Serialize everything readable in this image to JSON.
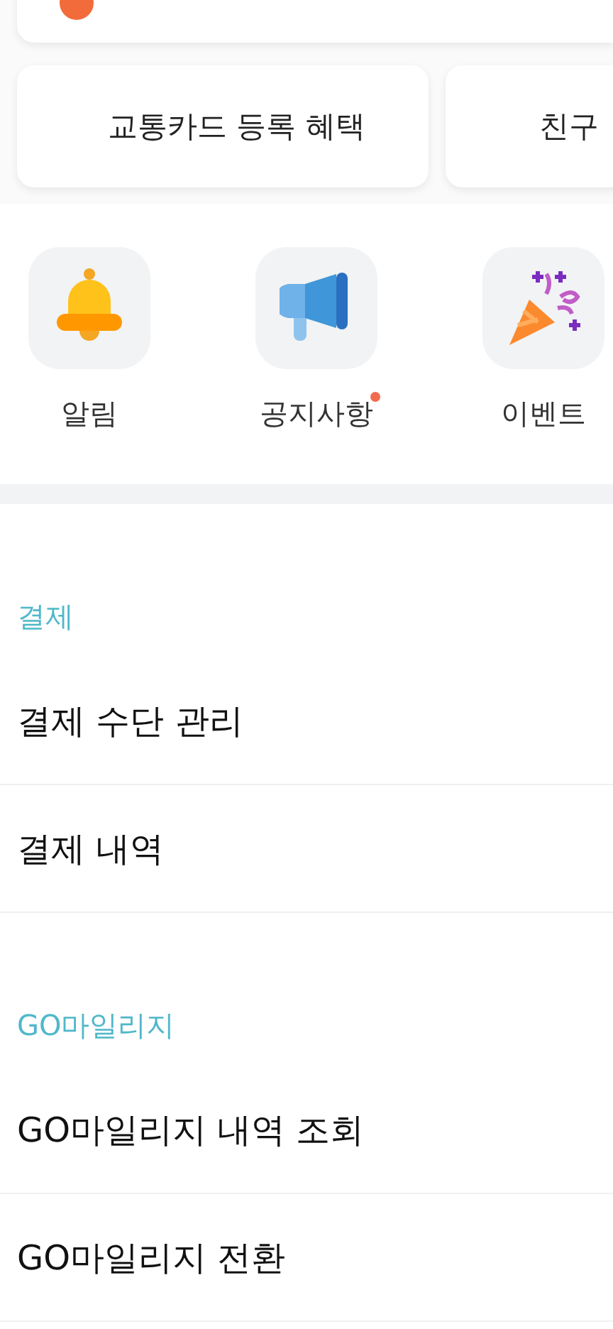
{
  "shortcuts": [
    {
      "label": "교통카드 등록 혜택"
    },
    {
      "label": "친구"
    }
  ],
  "menu_icons": [
    {
      "kind": "bell",
      "label": "알림",
      "new": false
    },
    {
      "kind": "megaphone",
      "label": "공지사항",
      "new": true
    },
    {
      "kind": "party",
      "label": "이벤트",
      "new": false
    }
  ],
  "sections": [
    {
      "title": "결제",
      "items": [
        "결제 수단 관리",
        "결제 내역"
      ]
    },
    {
      "title": "GO마일리지",
      "items": [
        "GO마일리지 내역 조회",
        "GO마일리지 전환"
      ]
    }
  ]
}
